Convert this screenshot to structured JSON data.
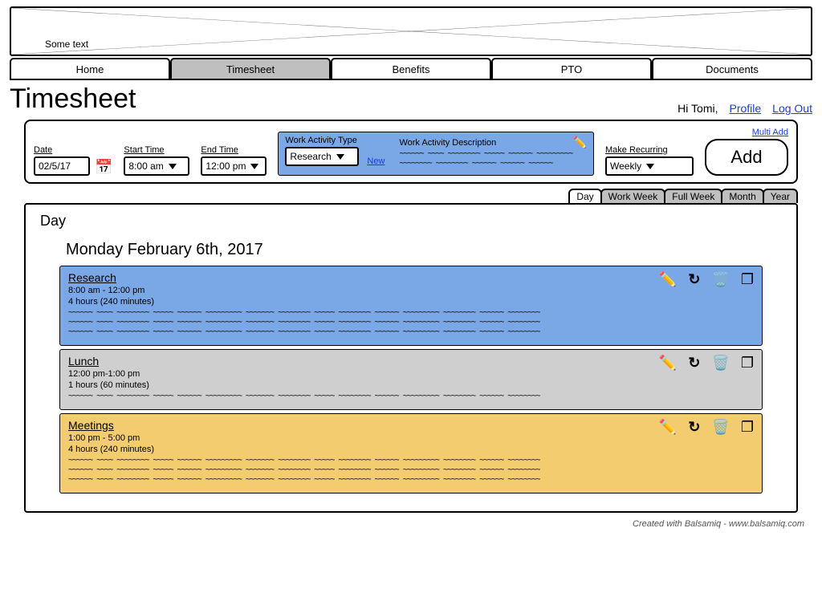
{
  "banner_text": "Some text",
  "nav": {
    "tabs": [
      "Home",
      "Timesheet",
      "Benefits",
      "PTO",
      "Documents"
    ],
    "active_index": 1
  },
  "page_title": "Timesheet",
  "user": {
    "greeting": "Hi Tomi,",
    "profile": "Profile",
    "logout": "Log Out"
  },
  "form": {
    "date_label": "Date",
    "date_value": "02/5/17",
    "start_label": "Start Time",
    "start_value": "8:00 am",
    "end_label": "End Time",
    "end_value": "12:00 pm",
    "activity_type_label": "Work Activity Type",
    "activity_type_value": "Research",
    "new_link": "New",
    "activity_desc_label": "Work Activity Description",
    "recurring_label": "Make Recurring",
    "recurring_value": "Weekly",
    "multi_add": "Multi Add",
    "add": "Add"
  },
  "view_tabs": {
    "items": [
      "Day",
      "Work Week",
      "Full Week",
      "Month",
      "Year"
    ],
    "active_index": 0
  },
  "day": {
    "label": "Day",
    "date_heading": "Monday February 6th, 2017",
    "entries": [
      {
        "title": "Research",
        "time": "8:00 am - 12:00 pm",
        "duration": "4 hours (240 minutes)",
        "lines": 3,
        "color": "blue"
      },
      {
        "title": "Lunch",
        "time": "12:00 pm-1:00 pm",
        "duration": "1 hours (60 minutes)",
        "lines": 1,
        "color": "grey"
      },
      {
        "title": "Meetings",
        "time": "1:00 pm - 5:00 pm",
        "duration": "4 hours (240 minutes)",
        "lines": 3,
        "color": "yellow"
      }
    ]
  },
  "icons": {
    "calendar": "📅",
    "edit": "✏️",
    "redo": "↻",
    "trash": "🗑️",
    "copy": "❐",
    "caret": "▾"
  },
  "credit": "Created with Balsamiq - www.balsamiq.com"
}
